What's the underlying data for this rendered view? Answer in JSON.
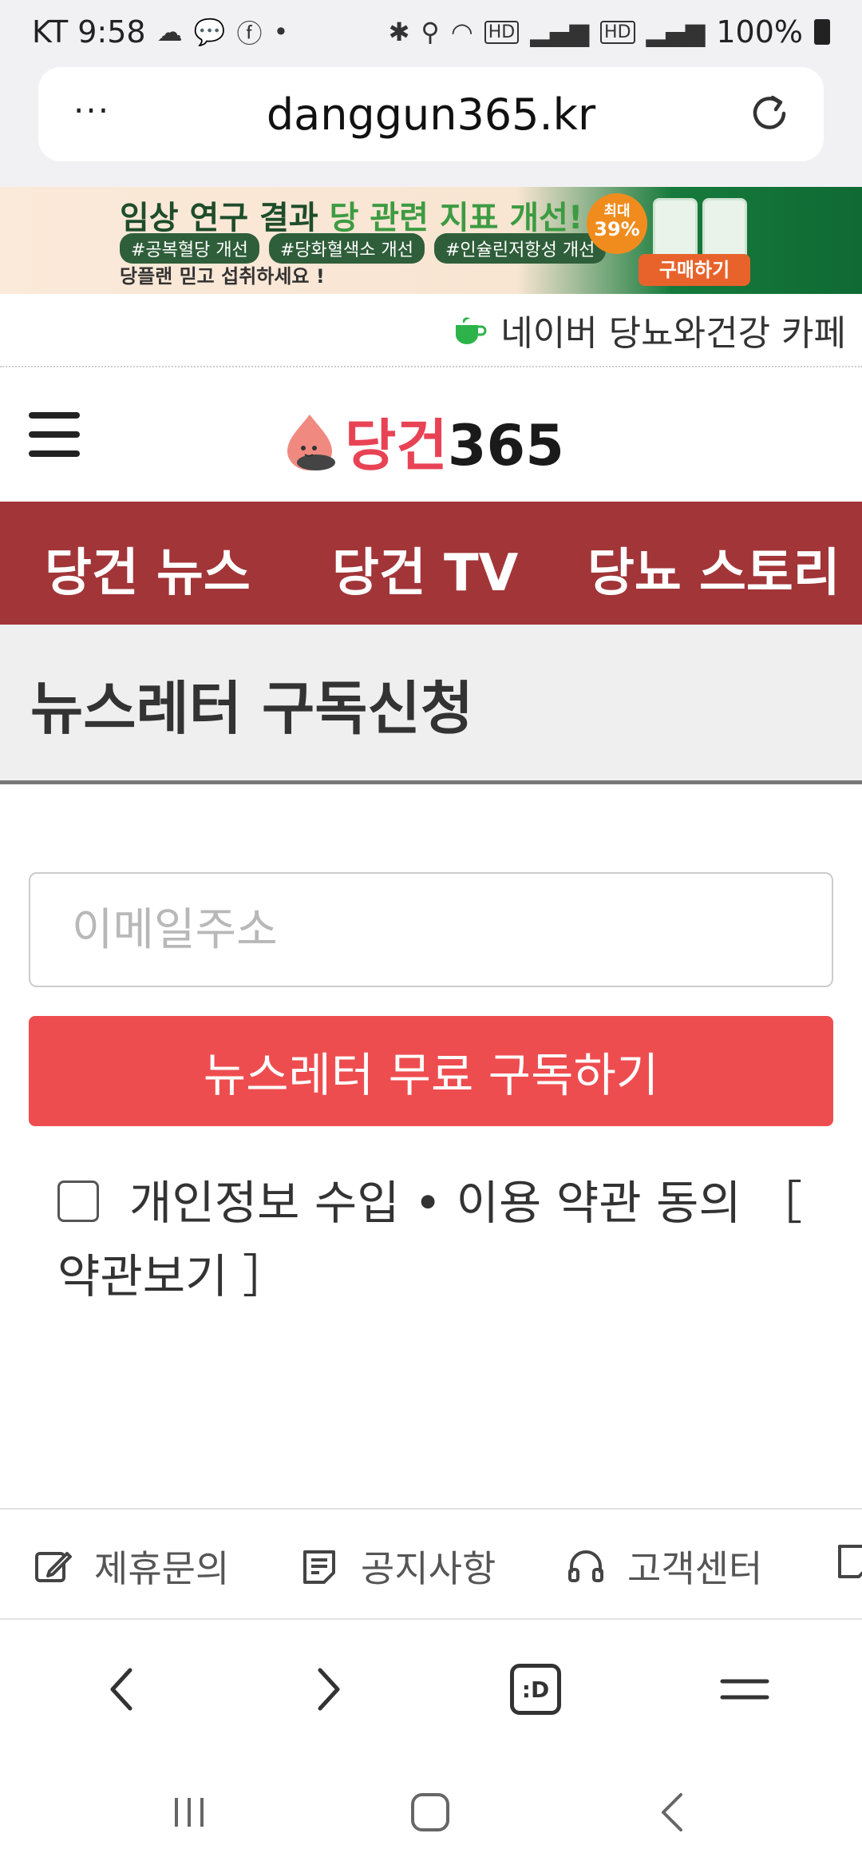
{
  "status_bar": {
    "carrier_time": "KT 9:58",
    "icons_left": [
      "cloud-icon",
      "kakaotalk-icon",
      "facebook-icon",
      "dot-icon"
    ],
    "icons_right": [
      "bluetooth-icon",
      "location-icon",
      "wifi-icon",
      "hd-icon",
      "signal-icon",
      "hd-icon",
      "signal-icon"
    ],
    "battery": "100%"
  },
  "browser": {
    "url": "danggun365.kr",
    "more_label": "···"
  },
  "banner": {
    "title_dark": "임상 연구 결과 ",
    "title_green": "당 관련 지표 개선!",
    "tags": [
      "#공복혈당 개선",
      "#당화혈색소 개선",
      "#인슐린저항성 개선"
    ],
    "subtitle": "당플랜 믿고 섭취하세요 !",
    "badge_top": "최대",
    "badge_value": "39%",
    "buy_label": "구매하기"
  },
  "cafe": {
    "label": "네이버 당뇨와건강 카페"
  },
  "header": {
    "logo_red": "당건",
    "logo_dark": "365"
  },
  "nav": {
    "items": [
      "당건 뉴스",
      "당건 TV",
      "당뇨 스토리"
    ]
  },
  "page": {
    "title": "뉴스레터 구독신청"
  },
  "form": {
    "email_placeholder": "이메일주소",
    "submit_label": "뉴스레터 무료 구독하기",
    "agree_label": "개인정보 수입 • 이용 약관 동의 ［ 약관보기 ］"
  },
  "footer": {
    "links": [
      "제휴문의",
      "공지사항",
      "고객센터"
    ]
  },
  "toolbar": {
    "tab_label": ":D"
  },
  "colors": {
    "nav_bg": "#a23538",
    "button_bg": "#ee4d50",
    "logo_red": "#e84355"
  }
}
